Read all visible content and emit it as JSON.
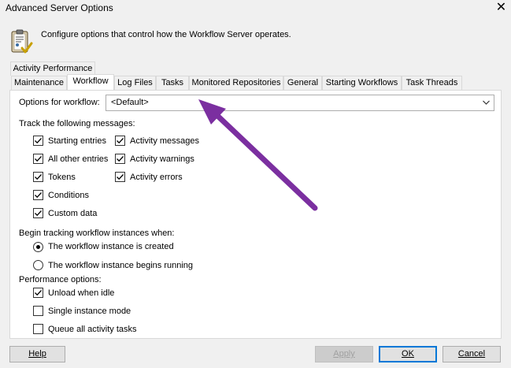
{
  "window": {
    "title": "Advanced Server Options",
    "close_glyph": "✕"
  },
  "header": {
    "description": "Configure options that control how the Workflow Server operates."
  },
  "tabs": {
    "row1": [
      {
        "label": "Activity Performance"
      }
    ],
    "row2": [
      {
        "label": "Maintenance"
      },
      {
        "label": "Workflow",
        "active": true
      },
      {
        "label": "Log Files"
      },
      {
        "label": "Tasks"
      },
      {
        "label": "Monitored Repositories"
      },
      {
        "label": "General"
      },
      {
        "label": "Starting Workflows"
      },
      {
        "label": "Task Threads"
      }
    ]
  },
  "workflow_tab": {
    "options_label": "Options for workflow:",
    "options_value": "<Default>",
    "track_label": "Track the following messages:",
    "track_left": [
      {
        "label": "Starting entries",
        "checked": true
      },
      {
        "label": "All other entries",
        "checked": true
      },
      {
        "label": "Tokens",
        "checked": true
      },
      {
        "label": "Conditions",
        "checked": true
      },
      {
        "label": "Custom data",
        "checked": true
      }
    ],
    "track_right": [
      {
        "label": "Activity messages",
        "checked": true
      },
      {
        "label": "Activity warnings",
        "checked": true
      },
      {
        "label": "Activity errors",
        "checked": true
      }
    ],
    "begin_label": "Begin tracking workflow instances when:",
    "begin_options": [
      {
        "label": "The workflow instance is created",
        "selected": true
      },
      {
        "label": "The workflow instance begins running",
        "selected": false
      }
    ],
    "perf_label": "Performance options:",
    "perf_options": [
      {
        "label": "Unload when idle",
        "checked": true
      },
      {
        "label": "Single instance mode",
        "checked": false
      },
      {
        "label": "Queue all activity tasks",
        "checked": false
      }
    ]
  },
  "buttons": {
    "help": {
      "label": "Help"
    },
    "apply": {
      "label": "Apply",
      "enabled": false
    },
    "ok": {
      "label": "OK",
      "default": true
    },
    "cancel": {
      "label": "Cancel"
    }
  },
  "colors": {
    "annotation_arrow": "#7b2fa0",
    "default_button_border": "#0078d7",
    "panel_background": "#ffffff",
    "window_background": "#f0f0f0"
  },
  "icons": {
    "header": "clipboard-check-icon",
    "combo": "chevron-down-icon",
    "close": "close-icon"
  }
}
